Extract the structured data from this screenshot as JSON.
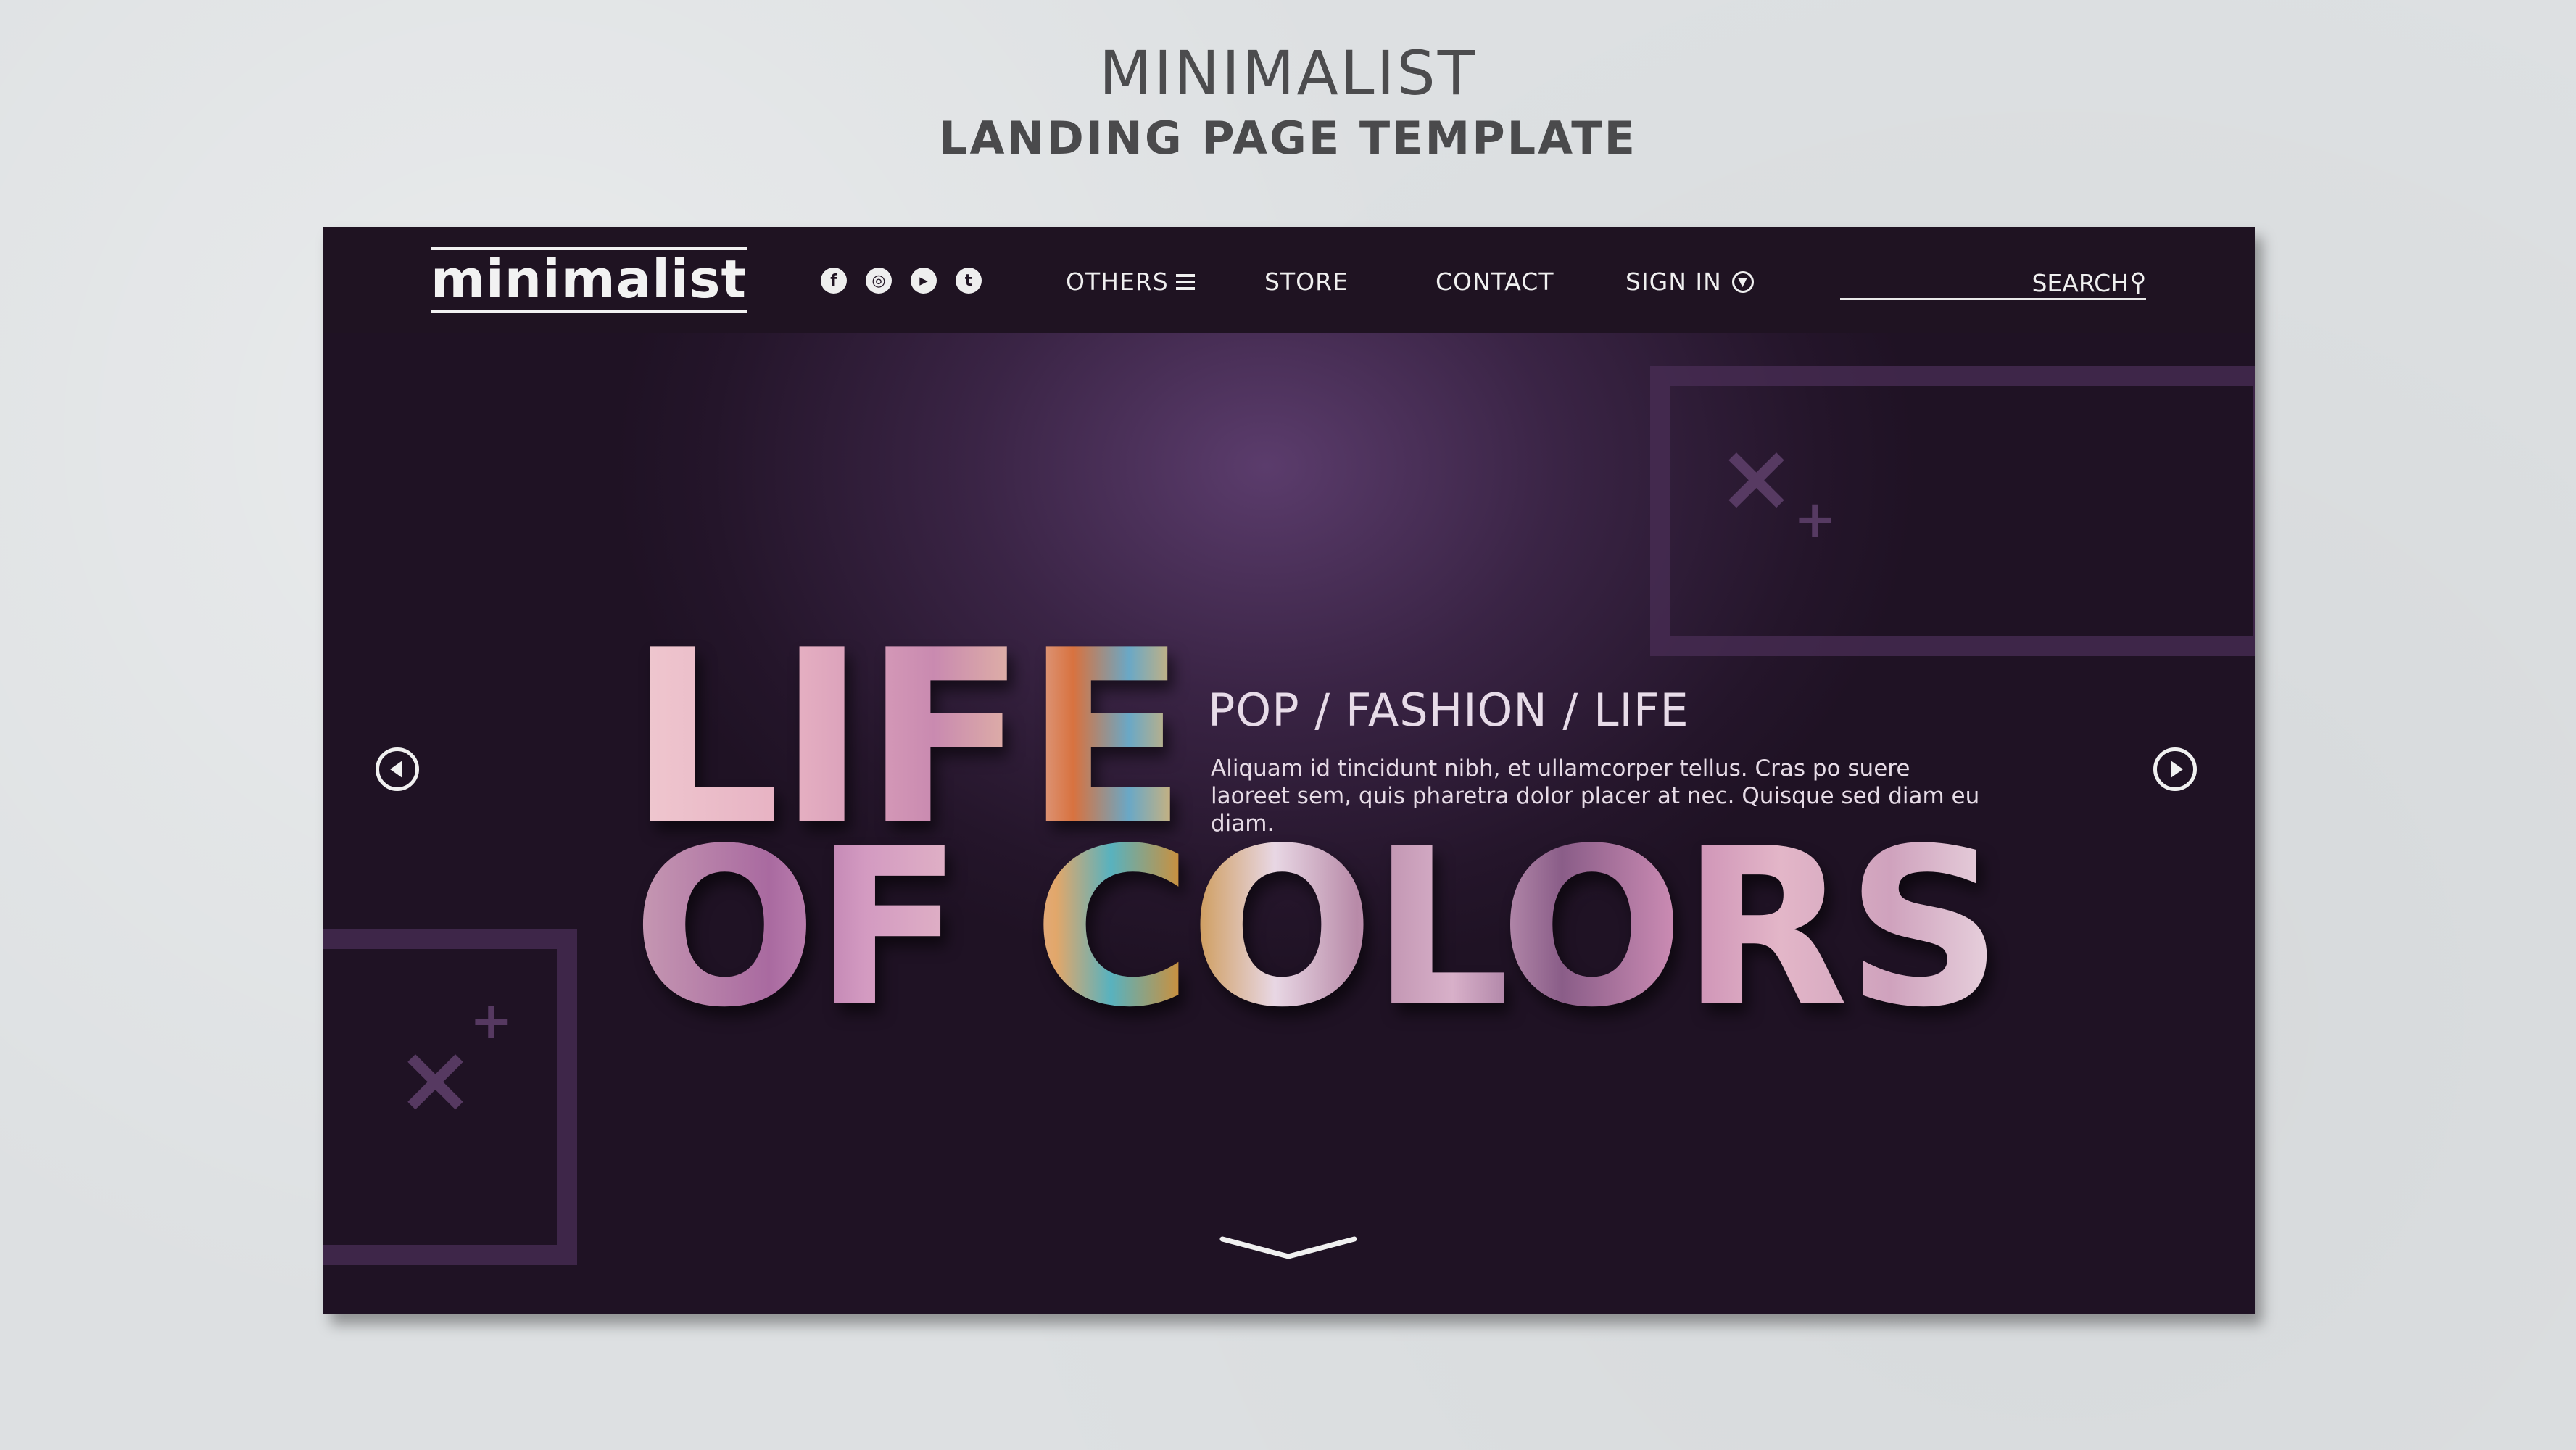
{
  "page": {
    "title": "MINIMALIST",
    "subtitle": "LANDING PAGE TEMPLATE"
  },
  "header": {
    "logo": "minimalist",
    "social": [
      {
        "name": "facebook-icon",
        "glyph": "f"
      },
      {
        "name": "instagram-icon",
        "glyph": "◎"
      },
      {
        "name": "youtube-icon",
        "glyph": "▶"
      },
      {
        "name": "twitter-icon",
        "glyph": "t"
      }
    ],
    "nav": {
      "others": "OTHERS",
      "store": "STORE",
      "contact": "CONTACT",
      "signin": "SIGN IN"
    },
    "search": {
      "label": "SEARCH",
      "placeholder": ""
    }
  },
  "hero": {
    "line1": "LIFE",
    "line2": "OF COLORS",
    "tagline": "POP / FASHION / LIFE",
    "description": "Aliquam id tincidunt nibh, et ullamcorper tellus. Cras po suere laoreet sem, quis pharetra dolor placer at nec. Quisque sed diam eu diam."
  },
  "colors": {
    "page_bg": "#dde0e2",
    "mock_bg": "#2d1b35",
    "topbar_bg": "#1f1322",
    "text_light": "#f0f0f0",
    "deco": "#4a2e56"
  }
}
